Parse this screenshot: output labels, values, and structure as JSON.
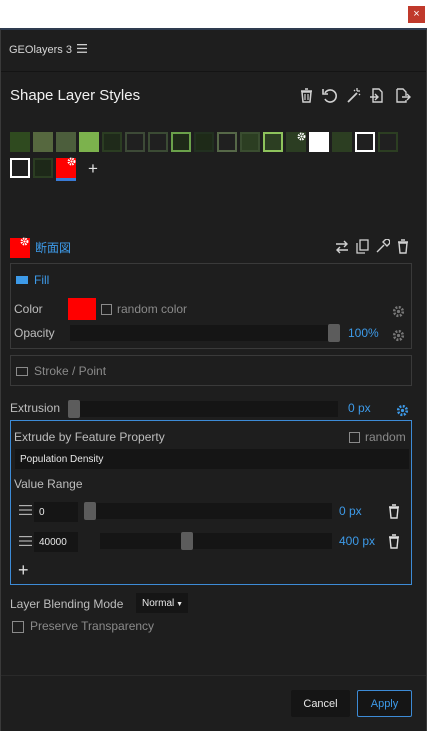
{
  "window": {
    "close_label": "×"
  },
  "header": {
    "app_title": "GEOlayers 3"
  },
  "panel": {
    "title": "Shape Layer Styles"
  },
  "colors": {
    "accent": "#3d9ae8",
    "selected_style": "#ff0000",
    "panel_bg": "#1e1e1e"
  },
  "toolbar": {
    "icons": [
      "trash-icon",
      "undo-icon",
      "magic-wand-icon",
      "import-icon",
      "export-icon"
    ]
  },
  "presets": {
    "add_label": "+"
  },
  "style": {
    "name": "断面図",
    "fill": {
      "label": "Fill",
      "color_label": "Color",
      "color_value": "#ff0000",
      "random_label": "random color",
      "opacity_label": "Opacity",
      "opacity_value": "100%",
      "opacity_level": 1.0
    },
    "stroke": {
      "label": "Stroke / Point"
    },
    "extrusion": {
      "label": "Extrusion",
      "value": "0 px",
      "level": 0.0,
      "feature": {
        "label": "Extrude by Feature Property",
        "random_label": "random",
        "property": "Population Density",
        "range_label": "Value Range",
        "rows": [
          {
            "input": "0",
            "value": "0 px",
            "level": 0.0
          },
          {
            "input": "40000",
            "value": "400 px",
            "level": 0.37
          }
        ],
        "add_label": "+"
      }
    },
    "blending": {
      "label": "Layer Blending Mode",
      "mode": "Normal"
    },
    "preserve_label": "Preserve Transparency"
  },
  "footer": {
    "cancel_label": "Cancel",
    "apply_label": "Apply"
  }
}
